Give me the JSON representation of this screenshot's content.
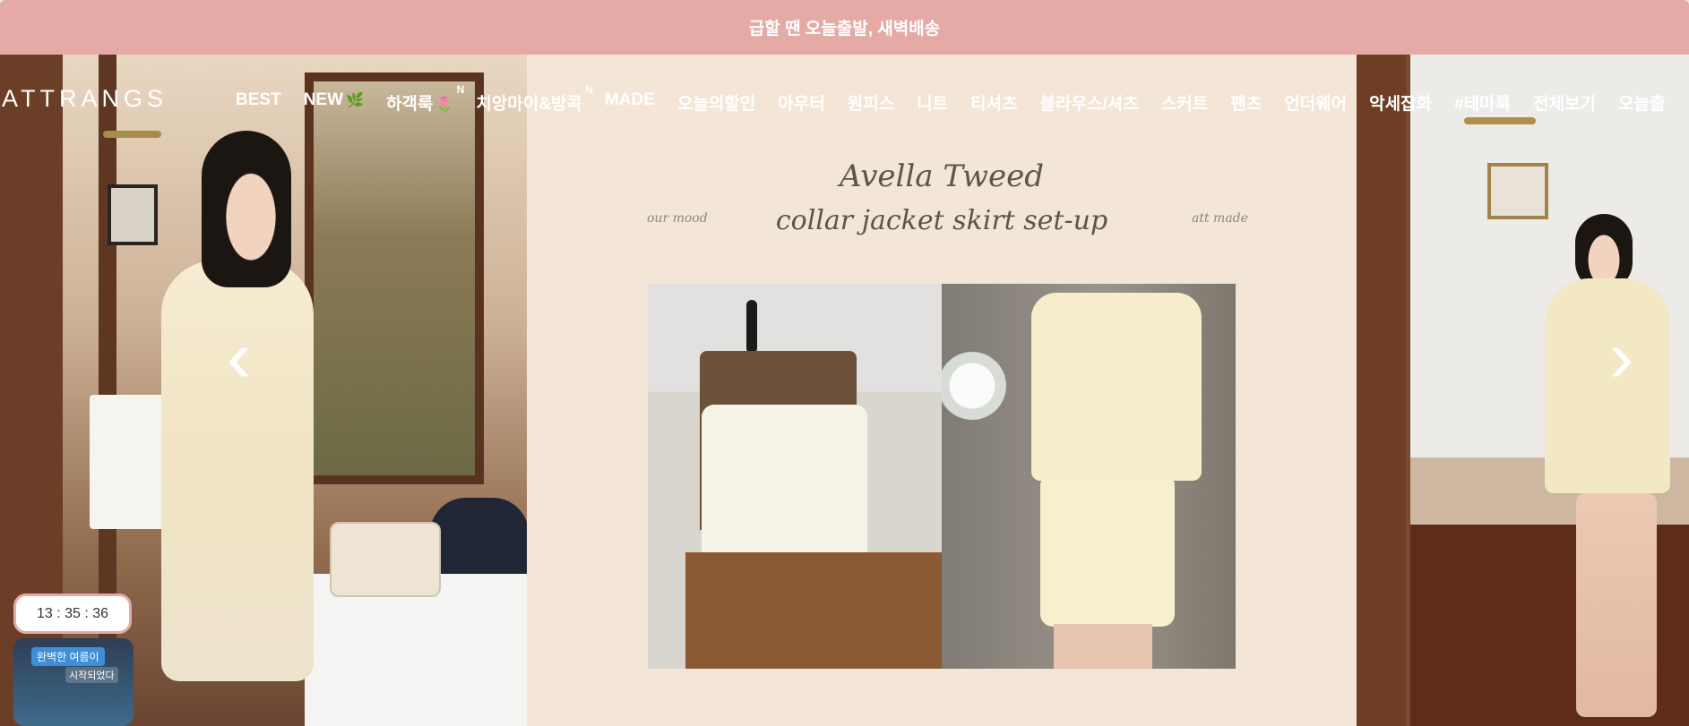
{
  "announcement": {
    "text": "급할 땐 오늘출발, 새벽배송"
  },
  "header": {
    "logo": "ATTRANGS",
    "nav": [
      {
        "label": "BEST"
      },
      {
        "label": "NEW",
        "badge": "🌿"
      },
      {
        "label": "하객룩",
        "badge": "🌷",
        "sup": "N"
      },
      {
        "label": "치앙마이&방콕",
        "sup": "N"
      },
      {
        "label": "MADE"
      },
      {
        "label": "오늘의할인"
      },
      {
        "label": "아우터"
      },
      {
        "label": "원피스"
      },
      {
        "label": "니트"
      },
      {
        "label": "티셔츠"
      },
      {
        "label": "블라우스/셔츠"
      },
      {
        "label": "스커트"
      },
      {
        "label": "팬츠"
      },
      {
        "label": "언더웨어"
      },
      {
        "label": "악세잡화"
      },
      {
        "label": "#테마룩"
      },
      {
        "label": "전체보기"
      },
      {
        "label": "오늘출"
      }
    ]
  },
  "hero": {
    "title_line1": "Avella Tweed",
    "title_line2": "collar jacket skirt set-up",
    "left_tag": "our mood",
    "right_tag": "att made",
    "prev_icon": "‹",
    "next_icon": "›"
  },
  "timer": {
    "text": "13 : 35 : 36"
  },
  "thumb": {
    "line1": "완벽한 여름이",
    "line2": "시작되었다"
  },
  "colors": {
    "announcement_bg": "#e6aaa6",
    "hero_bg": "#f3e6d6",
    "text_light": "#ffffff"
  }
}
